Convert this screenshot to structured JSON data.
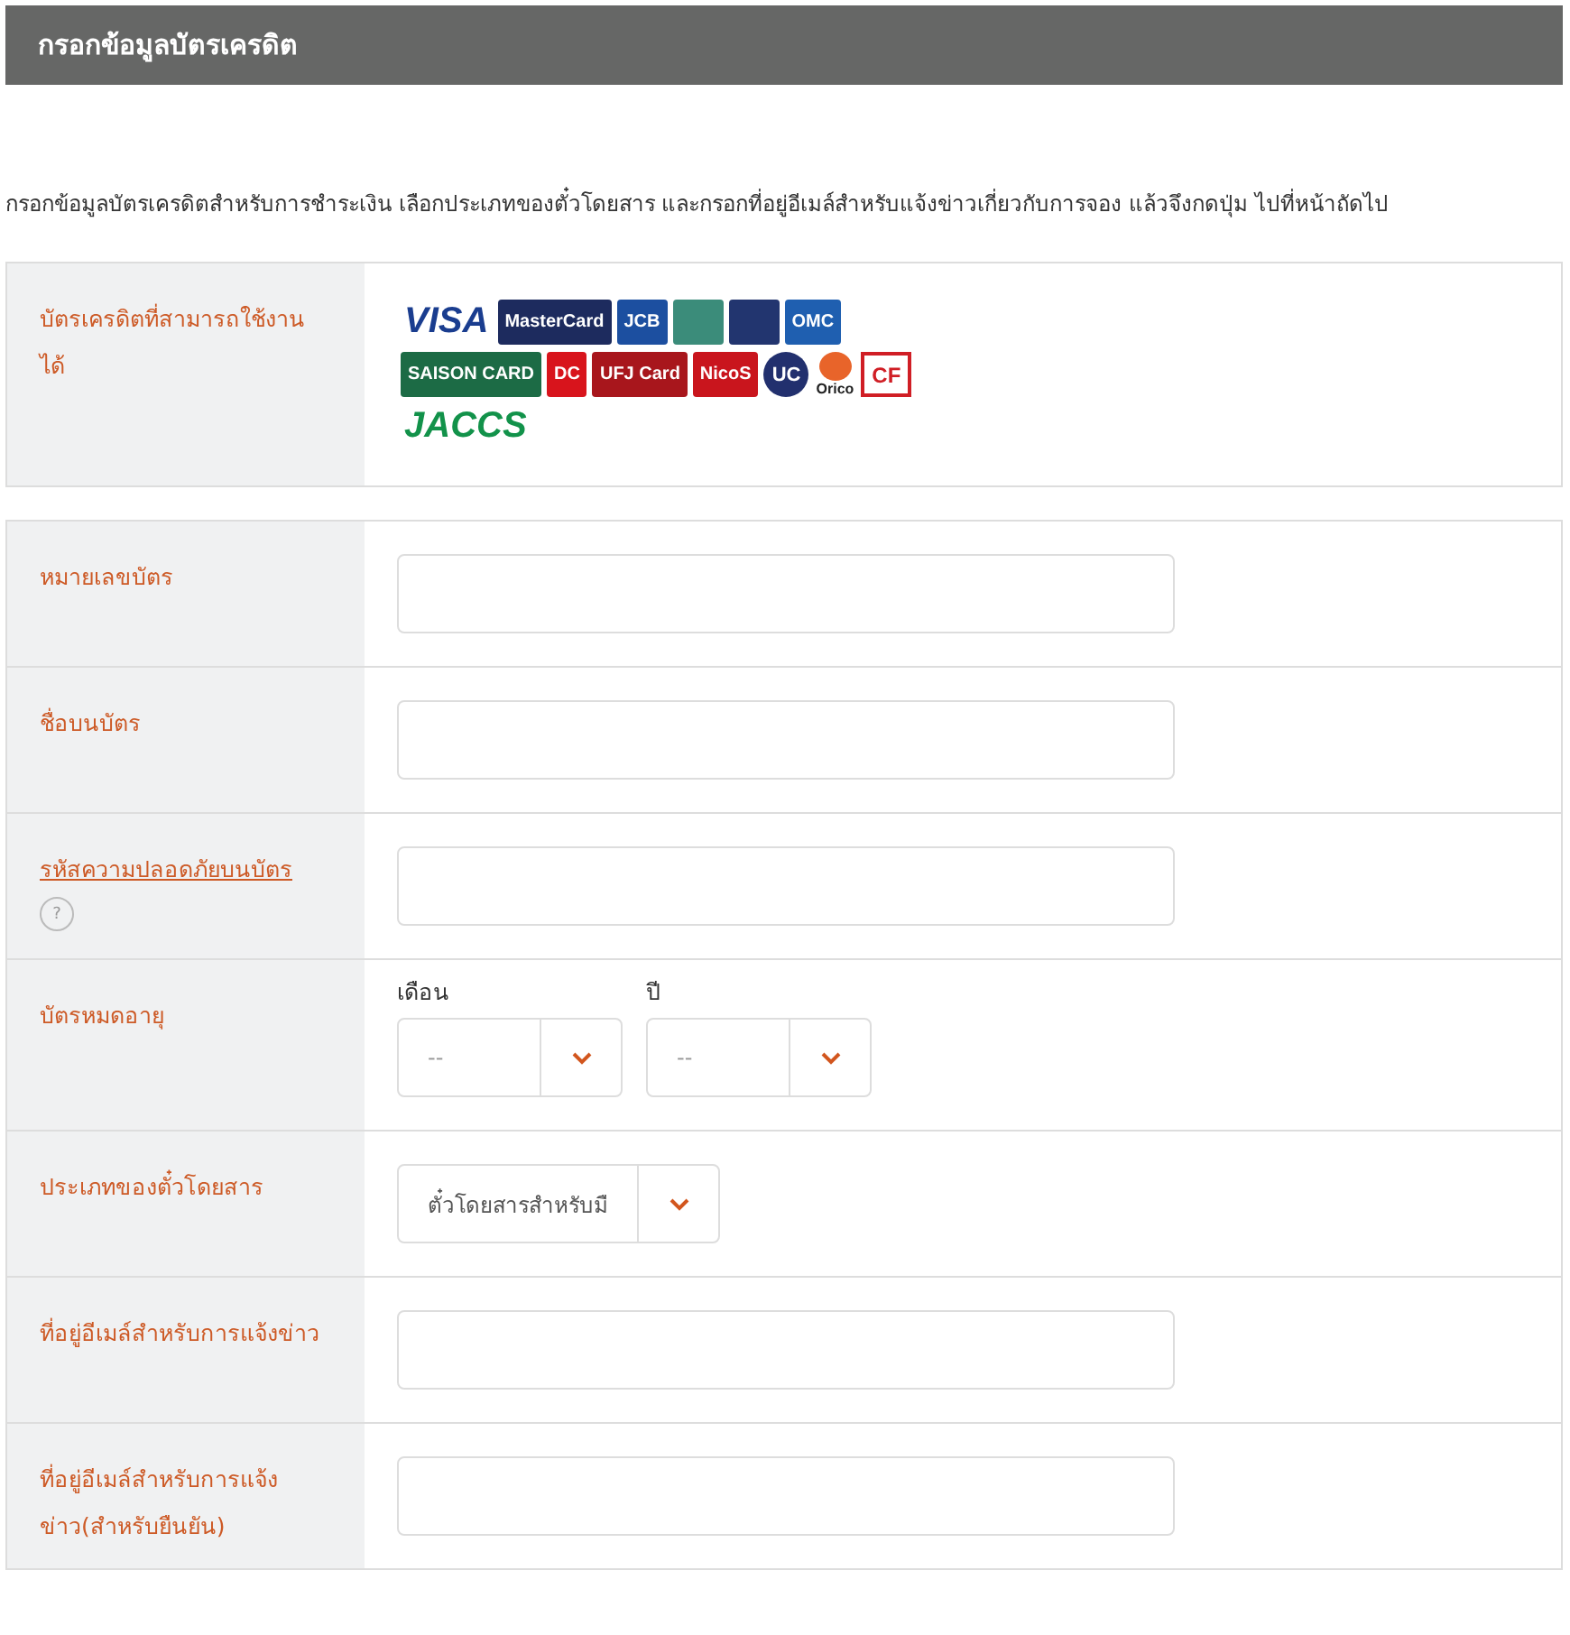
{
  "header": {
    "title": "กรอกข้อมูลบัตรเครดิต"
  },
  "intro": "กรอกข้อมูลบัตรเครดิตสำหรับการชำระเงิน เลือกประเภทของตั๋วโดยสาร และกรอกที่อยู่อีเมล์สำหรับแจ้งข่าวเกี่ยวกับการจอง แล้วจึงกดปุ่ม ไปที่หน้าถัดไป",
  "accepted_cards": {
    "label": "บัตรเครดิตที่สามารถใช้งานได้",
    "logos": [
      {
        "label": "VISA",
        "color": "#1a3d8f",
        "kind": "plain"
      },
      {
        "label": "MasterCard",
        "color": "#1d2b5e",
        "kind": "boxed"
      },
      {
        "label": "JCB",
        "color": "#1c4fa0",
        "kind": "boxed"
      },
      {
        "color": "#3b8c7a",
        "kind": "blank"
      },
      {
        "color": "#22356f",
        "kind": "blank"
      },
      {
        "label": "OMC",
        "color": "#1f5fb0",
        "kind": "boxed"
      },
      {
        "label": "SAISON CARD",
        "color": "#1c6b45",
        "kind": "boxed"
      },
      {
        "label": "DC",
        "color": "#d8141c",
        "kind": "boxed"
      },
      {
        "label": "UFJ Card",
        "color": "#a8161c",
        "kind": "boxed"
      },
      {
        "label": "NicoS",
        "color": "#c9151d",
        "kind": "boxed"
      },
      {
        "label": "UC",
        "color": "#22306e",
        "kind": "round"
      },
      {
        "label": "Orico",
        "color": "#e8642a",
        "kind": "dot"
      },
      {
        "label": "CF",
        "color": "#d01e25",
        "kind": "outlined"
      },
      {
        "label": "JACCS",
        "color": "#12924a",
        "kind": "plain"
      }
    ]
  },
  "form_rows": [
    {
      "kind": "text",
      "label": "หมายเลขบัตร"
    },
    {
      "kind": "text",
      "label": "ชื่อบนบัตร"
    },
    {
      "kind": "help",
      "label": "รหัสความปลอดภัยบนบัตร",
      "help": "?"
    },
    {
      "kind": "expiry",
      "label": "บัตรหมดอายุ",
      "selects": [
        {
          "label": "เดือน",
          "value": "--"
        },
        {
          "label": "ปี",
          "value": "--"
        }
      ]
    },
    {
      "kind": "select",
      "label": "ประเภทของตั๋วโดยสาร",
      "value": "ตั๋วโดยสารสำหรับมื"
    },
    {
      "kind": "text",
      "label": "ที่อยู่อีเมล์สำหรับการแจ้งข่าว"
    },
    {
      "kind": "text",
      "label": "ที่อยู่อีเมล์สำหรับการแจ้งข่าว(สำหรับยืนยัน)"
    }
  ]
}
